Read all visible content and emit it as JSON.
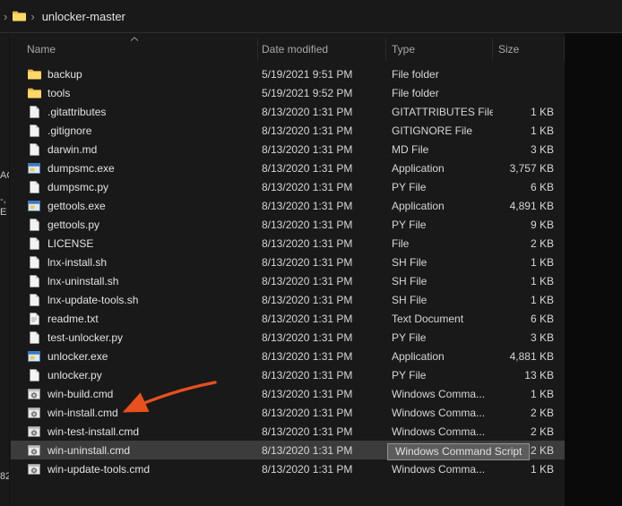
{
  "window": {
    "address": {
      "folder_name": "unlocker-master"
    },
    "columns": [
      {
        "label": "Name",
        "sort": "ascending"
      },
      {
        "label": "Date modified"
      },
      {
        "label": "Type"
      },
      {
        "label": "Size"
      }
    ],
    "files": [
      {
        "name": "backup",
        "date": "5/19/2021 9:51 PM",
        "type": "File folder",
        "size": "",
        "icon": "folder-icon"
      },
      {
        "name": "tools",
        "date": "5/19/2021 9:52 PM",
        "type": "File folder",
        "size": "",
        "icon": "folder-icon"
      },
      {
        "name": ".gitattributes",
        "date": "8/13/2020 1:31 PM",
        "type": "GITATTRIBUTES File",
        "size": "1 KB",
        "icon": "file-icon"
      },
      {
        "name": ".gitignore",
        "date": "8/13/2020 1:31 PM",
        "type": "GITIGNORE File",
        "size": "1 KB",
        "icon": "file-icon"
      },
      {
        "name": "darwin.md",
        "date": "8/13/2020 1:31 PM",
        "type": "MD File",
        "size": "3 KB",
        "icon": "file-icon"
      },
      {
        "name": "dumpsmc.exe",
        "date": "8/13/2020 1:31 PM",
        "type": "Application",
        "size": "3,757 KB",
        "icon": "app-icon"
      },
      {
        "name": "dumpsmc.py",
        "date": "8/13/2020 1:31 PM",
        "type": "PY File",
        "size": "6 KB",
        "icon": "file-icon"
      },
      {
        "name": "gettools.exe",
        "date": "8/13/2020 1:31 PM",
        "type": "Application",
        "size": "4,891 KB",
        "icon": "app-icon"
      },
      {
        "name": "gettools.py",
        "date": "8/13/2020 1:31 PM",
        "type": "PY File",
        "size": "9 KB",
        "icon": "file-icon"
      },
      {
        "name": "LICENSE",
        "date": "8/13/2020 1:31 PM",
        "type": "File",
        "size": "2 KB",
        "icon": "file-icon"
      },
      {
        "name": "lnx-install.sh",
        "date": "8/13/2020 1:31 PM",
        "type": "SH File",
        "size": "1 KB",
        "icon": "file-icon"
      },
      {
        "name": "lnx-uninstall.sh",
        "date": "8/13/2020 1:31 PM",
        "type": "SH File",
        "size": "1 KB",
        "icon": "file-icon"
      },
      {
        "name": "lnx-update-tools.sh",
        "date": "8/13/2020 1:31 PM",
        "type": "SH File",
        "size": "1 KB",
        "icon": "file-icon"
      },
      {
        "name": "readme.txt",
        "date": "8/13/2020 1:31 PM",
        "type": "Text Document",
        "size": "6 KB",
        "icon": "text-file-icon"
      },
      {
        "name": "test-unlocker.py",
        "date": "8/13/2020 1:31 PM",
        "type": "PY File",
        "size": "3 KB",
        "icon": "file-icon"
      },
      {
        "name": "unlocker.exe",
        "date": "8/13/2020 1:31 PM",
        "type": "Application",
        "size": "4,881 KB",
        "icon": "app-icon"
      },
      {
        "name": "unlocker.py",
        "date": "8/13/2020 1:31 PM",
        "type": "PY File",
        "size": "13 KB",
        "icon": "file-icon"
      },
      {
        "name": "win-build.cmd",
        "date": "8/13/2020 1:31 PM",
        "type": "Windows Comma...",
        "size": "1 KB",
        "icon": "cmd-icon"
      },
      {
        "name": "win-install.cmd",
        "date": "8/13/2020 1:31 PM",
        "type": "Windows Comma...",
        "size": "2 KB",
        "icon": "cmd-icon",
        "annotated": true
      },
      {
        "name": "win-test-install.cmd",
        "date": "8/13/2020 1:31 PM",
        "type": "Windows Comma...",
        "size": "2 KB",
        "icon": "cmd-icon"
      },
      {
        "name": "win-uninstall.cmd",
        "date": "8/13/2020 1:31 PM",
        "type": "Windows Comma...",
        "size": "2 KB",
        "icon": "cmd-icon",
        "highlighted": true
      },
      {
        "name": "win-update-tools.cmd",
        "date": "8/13/2020 1:31 PM",
        "type": "Windows Comma...",
        "size": "1 KB",
        "icon": "cmd-icon"
      }
    ],
    "tooltip": "Windows Command Script",
    "left_pane_fragments": [
      {
        "text": "AC"
      },
      {
        "text": "-,"
      },
      {
        "text": "E"
      },
      {
        "text": "82"
      }
    ],
    "colors": {
      "background": "#191919",
      "folder_yellow": "#ffd968",
      "arrow_red": "#e8501e",
      "highlight_row": "#3c3c3c"
    }
  }
}
